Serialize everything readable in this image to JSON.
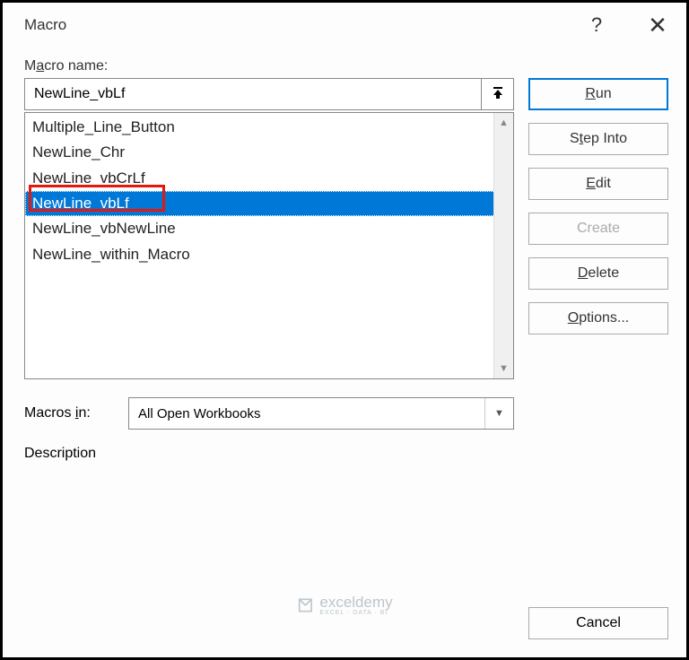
{
  "dialog": {
    "title": "Macro",
    "help_symbol": "?",
    "close_symbol": "✕"
  },
  "labels": {
    "macro_name_prefix": "M",
    "macro_name_underline": "a",
    "macro_name_suffix": "cro name:",
    "macros_in_prefix": "Macros ",
    "macros_in_underline": "i",
    "macros_in_suffix": "n:",
    "description": "Description"
  },
  "name_input": {
    "value": "NewLine_vbLf"
  },
  "list": {
    "items": [
      {
        "label": "Multiple_Line_Button",
        "selected": false
      },
      {
        "label": "NewLine_Chr",
        "selected": false
      },
      {
        "label": "NewLine_vbCrLf",
        "selected": false
      },
      {
        "label": "NewLine_vbLf",
        "selected": true
      },
      {
        "label": "NewLine_vbNewLine",
        "selected": false
      },
      {
        "label": "NewLine_within_Macro",
        "selected": false
      }
    ]
  },
  "buttons": {
    "run_underline": "R",
    "run_suffix": "un",
    "step_prefix": "S",
    "step_underline": "t",
    "step_suffix": "ep Into",
    "edit_underline": "E",
    "edit_suffix": "dit",
    "create": "Create",
    "delete_underline": "D",
    "delete_suffix": "elete",
    "options_underline": "O",
    "options_suffix": "ptions...",
    "cancel": "Cancel"
  },
  "dropdown": {
    "value": "All Open Workbooks"
  },
  "watermark": {
    "text": "exceldemy",
    "tagline": "EXCEL · DATA · BI"
  }
}
